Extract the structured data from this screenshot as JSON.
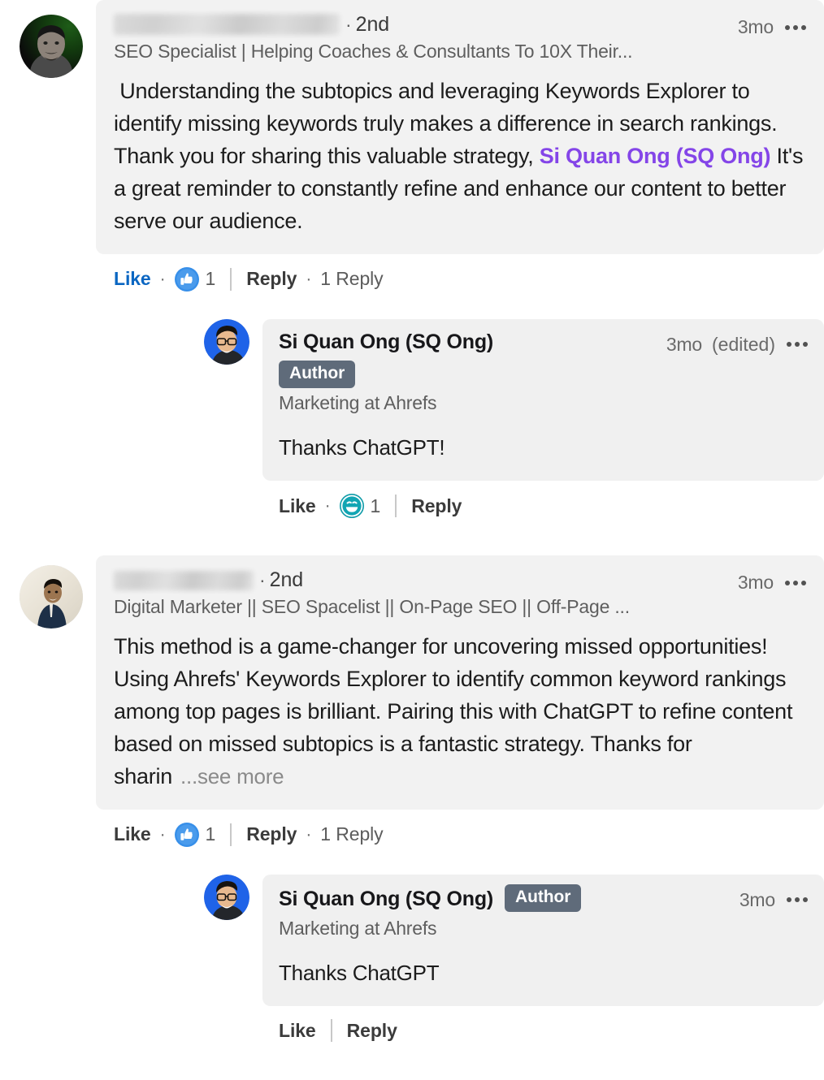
{
  "colors": {
    "bubble_bg": "#f2f2f2",
    "mention": "#8445e8",
    "like_active": "#0a66c2",
    "author_badge_bg": "#5f6b7a",
    "muted_text": "#5e5e5e"
  },
  "comments": [
    {
      "author": {
        "name_redacted": true,
        "degree": "2nd",
        "separator": "·",
        "headline": "SEO Specialist | Helping Coaches & Consultants To 10X Their...",
        "avatar_alt": "profile-photo-commenter-one"
      },
      "timestamp": "3mo",
      "menu_icon": "ellipsis-icon",
      "text_before_mention": " Understanding the subtopics and leveraging Keywords Explorer to identify missing keywords truly makes a difference in search rankings.\nThank you for sharing this valuable strategy, ",
      "mention": "Si Quan Ong (SQ Ong)",
      "text_after_mention": " It's a great reminder to constantly refine and enhance our content to better serve our audience.",
      "actions": {
        "like_label": "Like",
        "like_active": true,
        "reaction_icon": "thumbs-up-icon",
        "reaction_count": "1",
        "reply_label": "Reply",
        "replies_count_label": "1 Reply"
      },
      "replies": [
        {
          "author": {
            "name": "Si Quan Ong (SQ Ong)",
            "badge": "Author",
            "badge_inline": false,
            "headline": "Marketing at Ahrefs",
            "avatar_alt": "profile-photo-si-quan-ong"
          },
          "timestamp": "3mo",
          "edited_label": "(edited)",
          "menu_icon": "ellipsis-icon",
          "text": "Thanks ChatGPT!",
          "actions": {
            "like_label": "Like",
            "like_active": false,
            "reaction_icon": "funny-face-icon",
            "reaction_count": "1",
            "reply_label": "Reply"
          }
        }
      ]
    },
    {
      "author": {
        "name_redacted": true,
        "degree": "2nd",
        "separator": "·",
        "headline": "Digital Marketer || SEO Spacelist || On-Page SEO || Off-Page ...",
        "avatar_alt": "profile-photo-commenter-two"
      },
      "timestamp": "3mo",
      "menu_icon": "ellipsis-icon",
      "text": "This method is a game-changer for uncovering missed opportunities! Using Ahrefs' Keywords Explorer to identify common keyword rankings among top pages is brilliant. Pairing this with ChatGPT to refine content based on missed subtopics is a fantastic strategy. Thanks for sharin",
      "see_more_label": "...see more",
      "actions": {
        "like_label": "Like",
        "like_active": false,
        "reaction_icon": "thumbs-up-icon",
        "reaction_count": "1",
        "reply_label": "Reply",
        "replies_count_label": "1 Reply"
      },
      "replies": [
        {
          "author": {
            "name": "Si Quan Ong (SQ Ong)",
            "badge": "Author",
            "badge_inline": true,
            "headline": "Marketing at Ahrefs",
            "avatar_alt": "profile-photo-si-quan-ong"
          },
          "timestamp": "3mo",
          "menu_icon": "ellipsis-icon",
          "text": "Thanks ChatGPT",
          "actions": {
            "like_label": "Like",
            "like_active": false,
            "reply_label": "Reply"
          }
        }
      ]
    }
  ]
}
